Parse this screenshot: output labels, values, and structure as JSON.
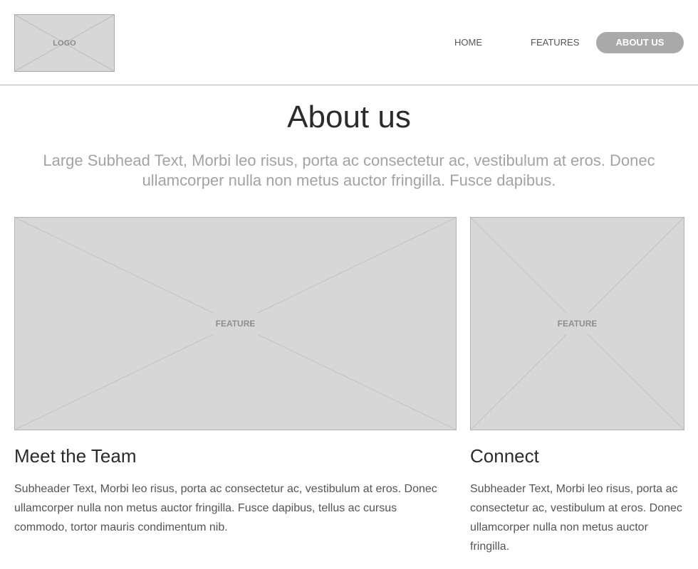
{
  "header": {
    "logo_label": "LOGO",
    "nav": {
      "home": "HOME",
      "features": "FEATURES",
      "about": "ABOUT US"
    }
  },
  "main": {
    "title": "About us",
    "subhead": "Large Subhead Text, Morbi leo risus, porta ac consectetur ac, vestibulum at eros. Donec ullamcorper nulla non metus auctor fringilla. Fusce dapibus."
  },
  "features": {
    "left_label": "FEATURE",
    "right_label": "FEATURE"
  },
  "sections": {
    "team": {
      "title": "Meet the Team",
      "text": "Subheader Text, Morbi leo risus, porta ac consectetur ac, vestibulum at eros. Donec ullamcorper nulla non metus auctor fringilla. Fusce dapibus, tellus ac cursus commodo, tortor mauris condimentum nib."
    },
    "connect": {
      "title": "Connect",
      "text": "Subheader Text, Morbi leo risus, porta ac consectetur ac, vestibulum at eros. Donec ullamcorper nulla non metus auctor fringilla."
    }
  },
  "colors": {
    "placeholder": "#d7d7d7",
    "active_nav": "#a9a9a9",
    "heading": "#2b2b2b",
    "subhead": "#a3a3a3"
  }
}
